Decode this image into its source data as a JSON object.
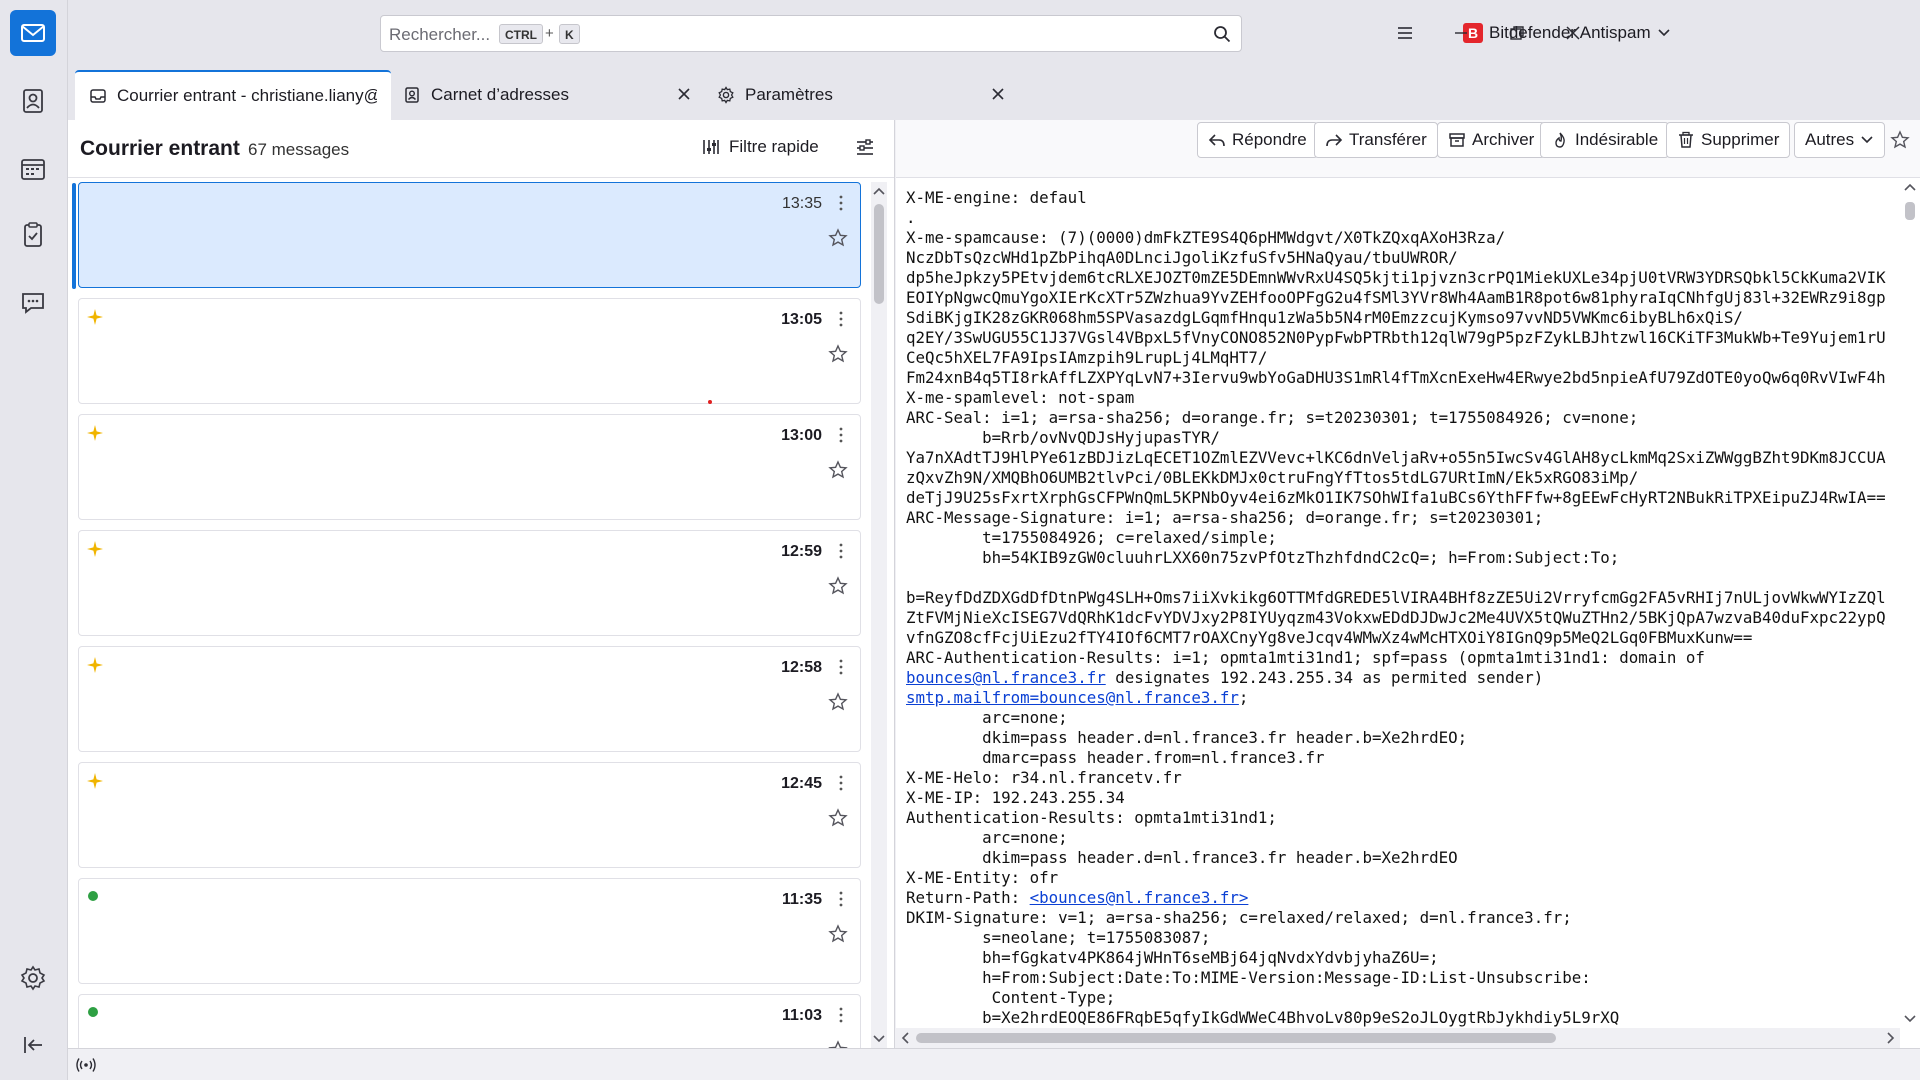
{
  "search": {
    "placeholder": "Rechercher...",
    "key_ctrl": "CTRL",
    "key_plus": "+",
    "key_k": "K"
  },
  "addon": {
    "logo_letter": "B",
    "label": "Bitdefender Antispam"
  },
  "tabs": [
    {
      "label": "Courrier entrant - christiane.liany@"
    },
    {
      "label": "Carnet d’adresses"
    },
    {
      "label": "Paramètres"
    }
  ],
  "list": {
    "folder": "Courrier entrant",
    "count": "67 messages",
    "quick_filter": "Filtre rapide",
    "messages": [
      {
        "time": "13:35"
      },
      {
        "time": "13:05"
      },
      {
        "time": "13:00"
      },
      {
        "time": "12:59"
      },
      {
        "time": "12:58"
      },
      {
        "time": "12:45"
      },
      {
        "time": "11:35"
      },
      {
        "time": "11:03"
      }
    ]
  },
  "toolbar": {
    "reply": "Répondre",
    "forward": "Transférer",
    "archive": "Archiver",
    "junk": "Indésirable",
    "delete": "Supprimer",
    "other": "Autres"
  },
  "source": {
    "l01": "X-ME-engine: defaul",
    "l02": ".",
    "l03": "X-me-spamcause: (7)(0000)dmFkZTE9S4Q6pHMWdgvt/X0TkZQxqAXoH3Rza/",
    "l04": "NczDbTsQzcWHd1pZbPihqA0DLnciJgoliKzfuSfv5HNaQyau/tbuUWROR/",
    "l05": "dp5heJpkzy5PEtvjdem6tcRLXEJOZT0mZE5DEmnWWvRxU4SQ5kjti1pjvzn3crPQ1MiekUXLe34pjU0tVRW3YDRSQbkl5CkKuma2VIK",
    "l06": "EOIYpNgwcQmuYgoXIErKcXTr5ZWzhua9YvZEHfooOPFgG2u4fSMl3YVr8Wh4AamB1R8pot6w81phyraIqCNhfgUj83l+32EWRz9i8gp",
    "l07": "SdiBKjgIK28zGKR068hm5SPVasazdgLGqmfHnqu1zWa5b5N4rM0EmzzcujKymso97vvND5VWKmc6ibyBLh6xQiS/",
    "l08": "q2EY/3SwUGU55C1J37VGsl4VBpxL5fVnyCONO852N0PypFwbPTRbth12qlW79gP5pzFZykLBJhtzwl16CKiTF3MukWb+Te9Yujem1rU",
    "l09": "CeQc5hXEL7FA9IpsIAmzpih9LrupLj4LMqHT7/",
    "l10": "Fm24xnB4q5TI8rkAffLZXPYqLvN7+3Iervu9wbYoGaDHU3S1mRl4fTmXcnExeHw4ERwye2bd5npieAfU79ZdOTE0yoQw6q0RvVIwF4h",
    "l11": "X-me-spamlevel: not-spam",
    "l12": "ARC-Seal: i=1; a=rsa-sha256; d=orange.fr; s=t20230301; t=1755084926; cv=none;",
    "l13": "        b=Rrb/ovNvQDJsHyjupasTYR/",
    "l14": "Ya7nXAdtTJ9HlPYe61zBDJizLqECET1OZmlEZVVevc+lKC6dnVeljaRv+o55n5IwcSv4GlAH8ycLkmMq2SxiZWWggBZht9DKm8JCCUA",
    "l15": "zQxvZh9N/XMQBhO6UMB2tlvPci/0BLEKkDMJx0ctruFngYfTtos5tdLG7URtImN/Ek5xRGO83iMp/",
    "l16": "deTjJ9U25sFxrtXrphGsCFPWnQmL5KPNbOyv4ei6zMkO1IK7SOhWIfa1uBCs6YthFFfw+8gEEwFcHyRT2NBukRiTPXEipuZJ4RwIA==",
    "l17": "ARC-Message-Signature: i=1; a=rsa-sha256; d=orange.fr; s=t20230301;",
    "l18": "        t=1755084926; c=relaxed/simple;",
    "l19": "        bh=54KIB9zGW0cluuhrLXX60n75zvPfOtzThzhfdndC2cQ=; h=From:Subject:To;",
    "l20": "",
    "l21": "b=ReyfDdZDXGdDfDtnPWg4SLH+Oms7iiXvkikg6OTTMfdGREDE5lVIRA4BHf8zZE5Ui2VrryfcmGg2FA5vRHIj7nULjovWkwWYIzZQl",
    "l22": "ZtFVMjNieXcISEG7VdQRhK1dcFvYDVJxy2P8IYUyqzm43VokxwEDdDJDwJc2Me4UVX5tQWuZTHn2/5BKjQpA7wzvaB40duFxpc22ypQ",
    "l23": "vfnGZO8cfFcjUiEzu2fTY4IOf6CMT7rOAXCnyYg8veJcqv4WMwXz4wMcHTXOiY8IGnQ9p5MeQ2LGq0FBMuxKunw==",
    "l24": "ARC-Authentication-Results: i=1; opmta1mti31nd1; spf=pass (opmta1mti31nd1: domain of",
    "l25_link": "bounces@nl.france3.fr",
    "l25_rest": " designates 192.243.255.34 as permited sender)",
    "l26_link": "smtp.mailfrom=bounces@nl.france3.fr",
    "l26_rest": ";",
    "l27": "        arc=none;",
    "l28": "        dkim=pass header.d=nl.france3.fr header.b=Xe2hrdEO;",
    "l29": "        dmarc=pass header.from=nl.france3.fr",
    "l30": "X-ME-Helo: r34.nl.francetv.fr",
    "l31": "X-ME-IP: 192.243.255.34",
    "l32": "Authentication-Results: opmta1mti31nd1;",
    "l33": "        arc=none;",
    "l34": "        dkim=pass header.d=nl.france3.fr header.b=Xe2hrdEO",
    "l35": "X-ME-Entity: ofr",
    "l36_prefix": "Return-Path: ",
    "l36_link": "<bounces@nl.france3.fr>",
    "l37": "DKIM-Signature: v=1; a=rsa-sha256; c=relaxed/relaxed; d=nl.france3.fr;",
    "l38": "        s=neolane; t=1755083087;",
    "l39": "        bh=fGgkatv4PK864jWHnT6seMBj64jqNvdxYdvbjyhaZ6U=;",
    "l40": "        h=From:Subject:Date:To:MIME-Version:Message-ID:List-Unsubscribe:",
    "l41": "         Content-Type;",
    "l42": "        b=Xe2hrdEOQE86FRqbE5qfyIkGdWWeC4BhvoLv80p9eS2oJLOygtRbJykhdiy5L9rXQ"
  }
}
